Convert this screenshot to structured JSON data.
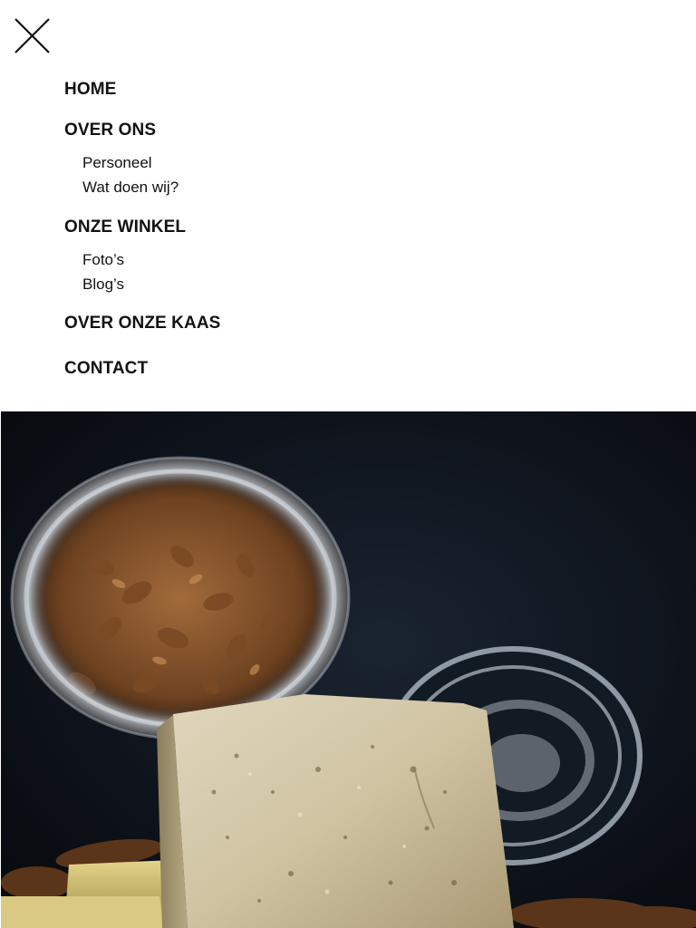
{
  "close": {
    "icon": "close-icon"
  },
  "menu": {
    "items": [
      {
        "label": "HOME"
      },
      {
        "label": "OVER ONS",
        "sub": [
          {
            "label": "Personeel"
          },
          {
            "label": "Wat doen wij?"
          }
        ]
      },
      {
        "label": "ONZE WINKEL",
        "sub": [
          {
            "label": "Foto’s"
          },
          {
            "label": "Blog’s"
          }
        ]
      },
      {
        "label": "OVER ONZE KAAS"
      },
      {
        "label": "CONTACT"
      }
    ]
  },
  "colors": {
    "text": "#111111",
    "background": "#ffffff",
    "hero_dark": "#0b0f16"
  }
}
